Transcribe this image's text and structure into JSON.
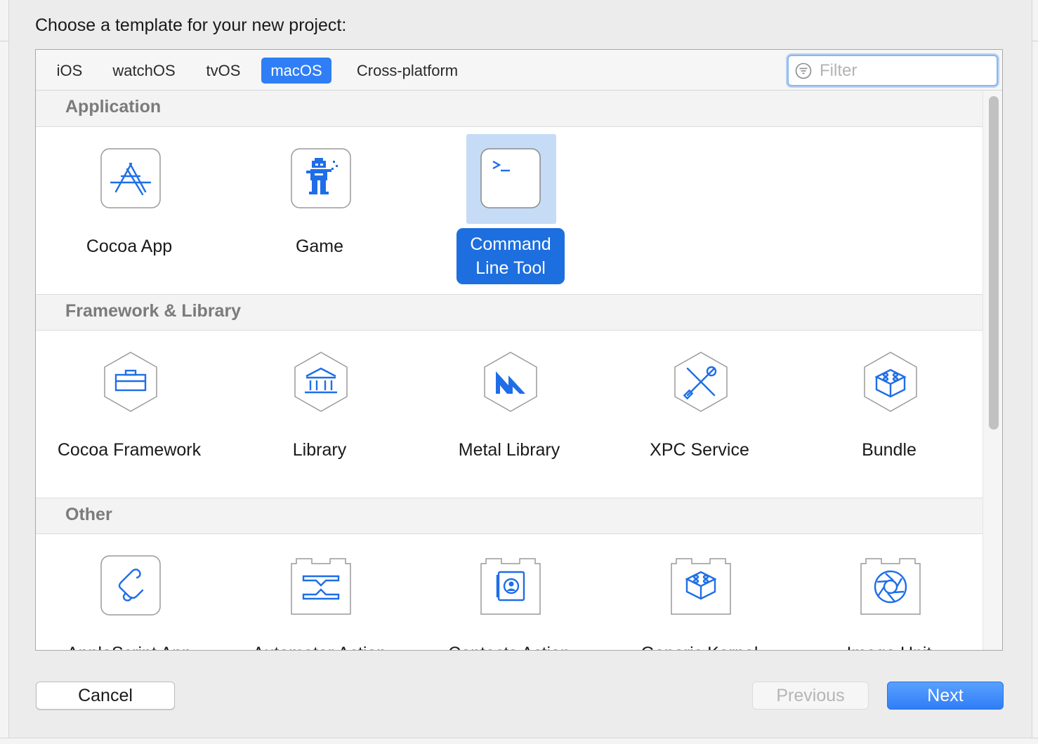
{
  "prompt": "Choose a template for your new project:",
  "tabs": [
    {
      "label": "iOS",
      "active": false
    },
    {
      "label": "watchOS",
      "active": false
    },
    {
      "label": "tvOS",
      "active": false
    },
    {
      "label": "macOS",
      "active": true
    },
    {
      "label": "Cross-platform",
      "active": false
    }
  ],
  "filter": {
    "placeholder": "Filter",
    "value": "",
    "icon": "filter-icon"
  },
  "sections": [
    {
      "title": "Application",
      "items": [
        {
          "label": "Cocoa App",
          "icon": "app-store-icon"
        },
        {
          "label": "Game",
          "icon": "game-icon"
        },
        {
          "label": "Command Line Tool",
          "icon": "terminal-icon",
          "selected": true
        }
      ]
    },
    {
      "title": "Framework & Library",
      "items": [
        {
          "label": "Cocoa Framework",
          "icon": "toolbox-icon"
        },
        {
          "label": "Library",
          "icon": "library-building-icon"
        },
        {
          "label": "Metal Library",
          "icon": "metal-icon"
        },
        {
          "label": "XPC Service",
          "icon": "tools-icon"
        },
        {
          "label": "Bundle",
          "icon": "lego-brick-icon"
        }
      ]
    },
    {
      "title": "Other",
      "items": [
        {
          "label": "AppleScript App",
          "icon": "script-scroll-icon"
        },
        {
          "label": "Automator Action",
          "icon": "automator-icon"
        },
        {
          "label": "Contacts Action",
          "icon": "contacts-icon"
        },
        {
          "label": "Generic Kernel",
          "icon": "kernel-brick-icon"
        },
        {
          "label": "Image Unit",
          "icon": "aperture-icon"
        }
      ]
    }
  ],
  "buttons": {
    "cancel": "Cancel",
    "previous": "Previous",
    "next": "Next"
  },
  "colors": {
    "accent": "#2f7ef6",
    "icon_blue": "#1e6ee8",
    "selection": "#c6dbf5",
    "selected_label": "#1d6ede"
  }
}
